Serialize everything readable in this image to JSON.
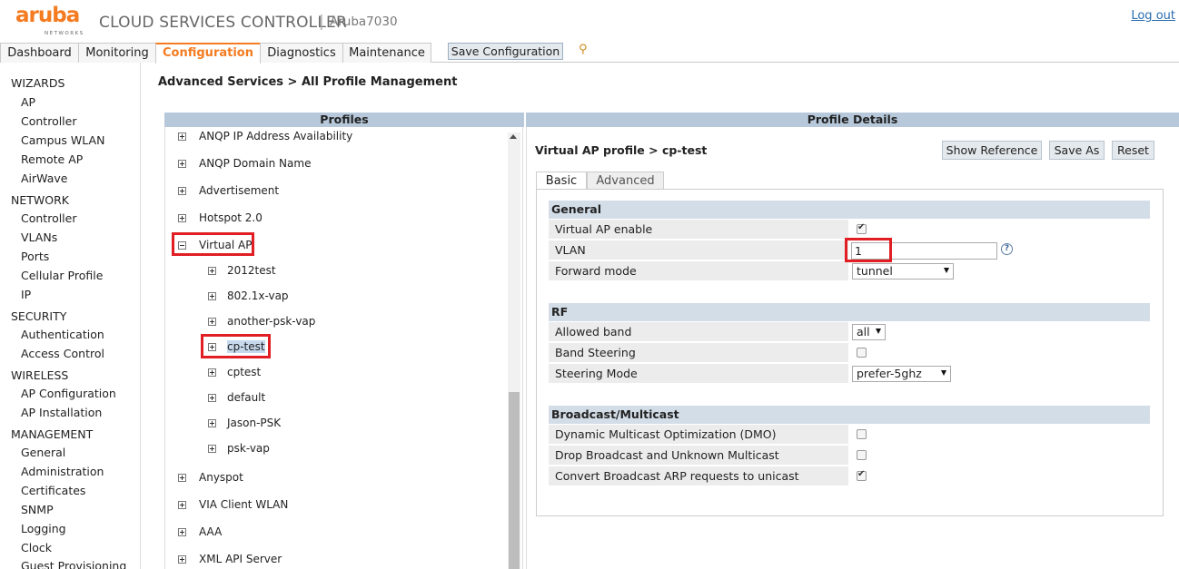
{
  "header": {
    "logo_text": "aruba",
    "logo_sub": "NETWORKS",
    "app_title": "CLOUD SERVICES CONTROLLER",
    "separator": "|",
    "host": "Aruba7030",
    "logout": "Log out"
  },
  "tabs": [
    {
      "label": "Dashboard"
    },
    {
      "label": "Monitoring"
    },
    {
      "label": "Configuration"
    },
    {
      "label": "Diagnostics"
    },
    {
      "label": "Maintenance"
    }
  ],
  "toolbar": {
    "save_label": "Save Configuration",
    "pin_icon": "⚲"
  },
  "sidebar": {
    "items": [
      {
        "label": "WIZARDS"
      },
      {
        "label": "AP"
      },
      {
        "label": "Controller"
      },
      {
        "label": "Campus WLAN"
      },
      {
        "label": "Remote AP"
      },
      {
        "label": "AirWave"
      },
      {
        "label": "NETWORK"
      },
      {
        "label": "Controller"
      },
      {
        "label": "VLANs"
      },
      {
        "label": "Ports"
      },
      {
        "label": "Cellular Profile"
      },
      {
        "label": "IP"
      },
      {
        "label": "SECURITY"
      },
      {
        "label": "Authentication"
      },
      {
        "label": "Access Control"
      },
      {
        "label": "WIRELESS"
      },
      {
        "label": "AP Configuration"
      },
      {
        "label": "AP Installation"
      },
      {
        "label": "MANAGEMENT"
      },
      {
        "label": "General"
      },
      {
        "label": "Administration"
      },
      {
        "label": "Certificates"
      },
      {
        "label": "SNMP"
      },
      {
        "label": "Logging"
      },
      {
        "label": "Clock"
      },
      {
        "label": "Guest Provisioning"
      }
    ]
  },
  "breadcrumb": "Advanced Services > All Profile Management",
  "profiles": {
    "header": "Profiles",
    "tree": [
      {
        "label": "ANQP IP Address Availability"
      },
      {
        "label": "ANQP Domain Name"
      },
      {
        "label": "Advertisement"
      },
      {
        "label": "Hotspot 2.0"
      },
      {
        "label": "Virtual AP"
      },
      {
        "label": "2012test"
      },
      {
        "label": "802.1x-vap"
      },
      {
        "label": "another-psk-vap"
      },
      {
        "label": "cp-test"
      },
      {
        "label": "cptest"
      },
      {
        "label": "default"
      },
      {
        "label": "Jason-PSK"
      },
      {
        "label": "psk-vap"
      },
      {
        "label": "Anyspot"
      },
      {
        "label": "VIA Client WLAN"
      },
      {
        "label": "AAA"
      },
      {
        "label": "XML API Server"
      }
    ]
  },
  "details": {
    "header": "Profile Details",
    "title": "Virtual AP profile > cp-test",
    "buttons": {
      "show_reference": "Show Reference",
      "save_as": "Save As",
      "reset": "Reset"
    },
    "tabs": {
      "basic": "Basic",
      "advanced": "Advanced"
    },
    "general": {
      "title": "General",
      "virtual_ap_enable": {
        "label": "Virtual AP enable",
        "checked": true
      },
      "vlan": {
        "label": "VLAN",
        "value": "1"
      },
      "forward_mode": {
        "label": "Forward mode",
        "value": "tunnel"
      }
    },
    "rf": {
      "title": "RF",
      "allowed_band": {
        "label": "Allowed band",
        "value": "all"
      },
      "band_steering": {
        "label": "Band Steering",
        "checked": false
      },
      "steering_mode": {
        "label": "Steering Mode",
        "value": "prefer-5ghz"
      }
    },
    "broadcast": {
      "title": "Broadcast/Multicast",
      "dmo": {
        "label": "Dynamic Multicast Optimization (DMO)",
        "checked": false
      },
      "drop_bcast": {
        "label": "Drop Broadcast and Unknown Multicast",
        "checked": false
      },
      "convert_arp": {
        "label": "Convert Broadcast ARP requests to unicast",
        "checked": true
      }
    },
    "help_icon": "?"
  },
  "colors": {
    "accent": "#f47b20",
    "panel_header": "#b6c8da",
    "highlight": "#e01e24",
    "link": "#2a6cb0"
  }
}
